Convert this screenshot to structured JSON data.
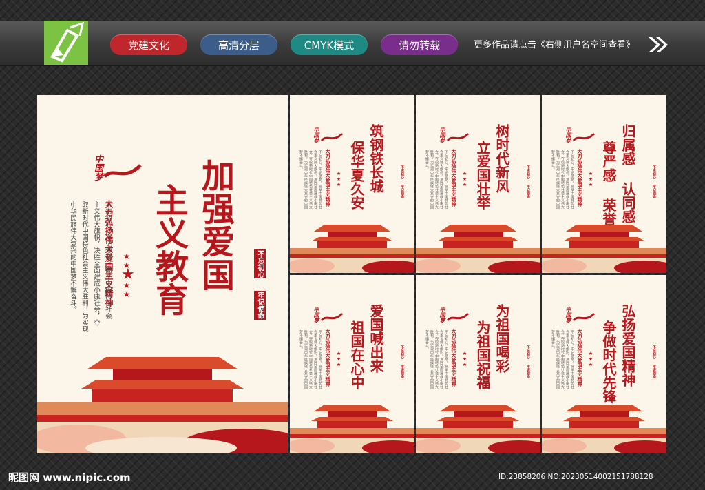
{
  "header": {
    "tags": [
      {
        "label": "党建文化",
        "color": "#c0272d"
      },
      {
        "label": "高清分层",
        "color": "#3c5d8a"
      },
      {
        "label": "CMYK模式",
        "color": "#1f8a84"
      },
      {
        "label": "请勿转载",
        "color": "#7a2e8c"
      }
    ],
    "tagline": "更多作品请点击《右侧用户名空间查看》"
  },
  "main_poster": {
    "logo": "中国梦",
    "title_col1": "加强爱国",
    "title_col2": "主义教育",
    "subtitle": "大力弘扬伟大爱国主义精神",
    "body_cols": [
      "不忘初心，牢记使命，高举中国特色社会",
      "主义伟大旗帜，决胜全面建成小康社会，夺",
      "取新时代中国特色社会主义伟大胜利，为实现",
      "中华民族伟大复兴的中国梦不懈奋斗。"
    ],
    "seal1": "不忘初心",
    "seal2": "牢记使命"
  },
  "small_posters": [
    {
      "title1": "筑钢铁长城",
      "title2": "保华夏久安"
    },
    {
      "title1": "树时代新风",
      "title2": "立爱国壮举"
    },
    {
      "title1": "归属感 认同感",
      "title2": "尊严感 荣誉感"
    },
    {
      "title1": "爱国喊出来",
      "title2": "祖国在心中"
    },
    {
      "title1": "为祖国喝彩",
      "title2": "为祖国祝福"
    },
    {
      "title1": "弘扬爱国精神",
      "title2": "争做时代先锋"
    }
  ],
  "small_common": {
    "logo": "中国梦",
    "subtitle": "大力弘扬伟大爱国主义精神",
    "body": "不忘初心，牢记使命，高举中国特色社会主义伟大旗帜，决胜全面建成小康社会，夺取新时代中国特色社会主义伟大胜利，为实现中华民族伟大复兴的中国梦不懈奋斗。",
    "seal1": "不忘初心",
    "seal2": "牢记使命"
  },
  "footer": {
    "site": "昵图网 www.nipic.com",
    "id": "ID:23858206 NO:20230514002151788128"
  },
  "colors": {
    "red": "#b5171c",
    "cream": "#fbf5ea",
    "logo_green": "#7cc243"
  },
  "icons": [
    "pen-logo-icon",
    "double-arrow-icon",
    "star-icon"
  ]
}
